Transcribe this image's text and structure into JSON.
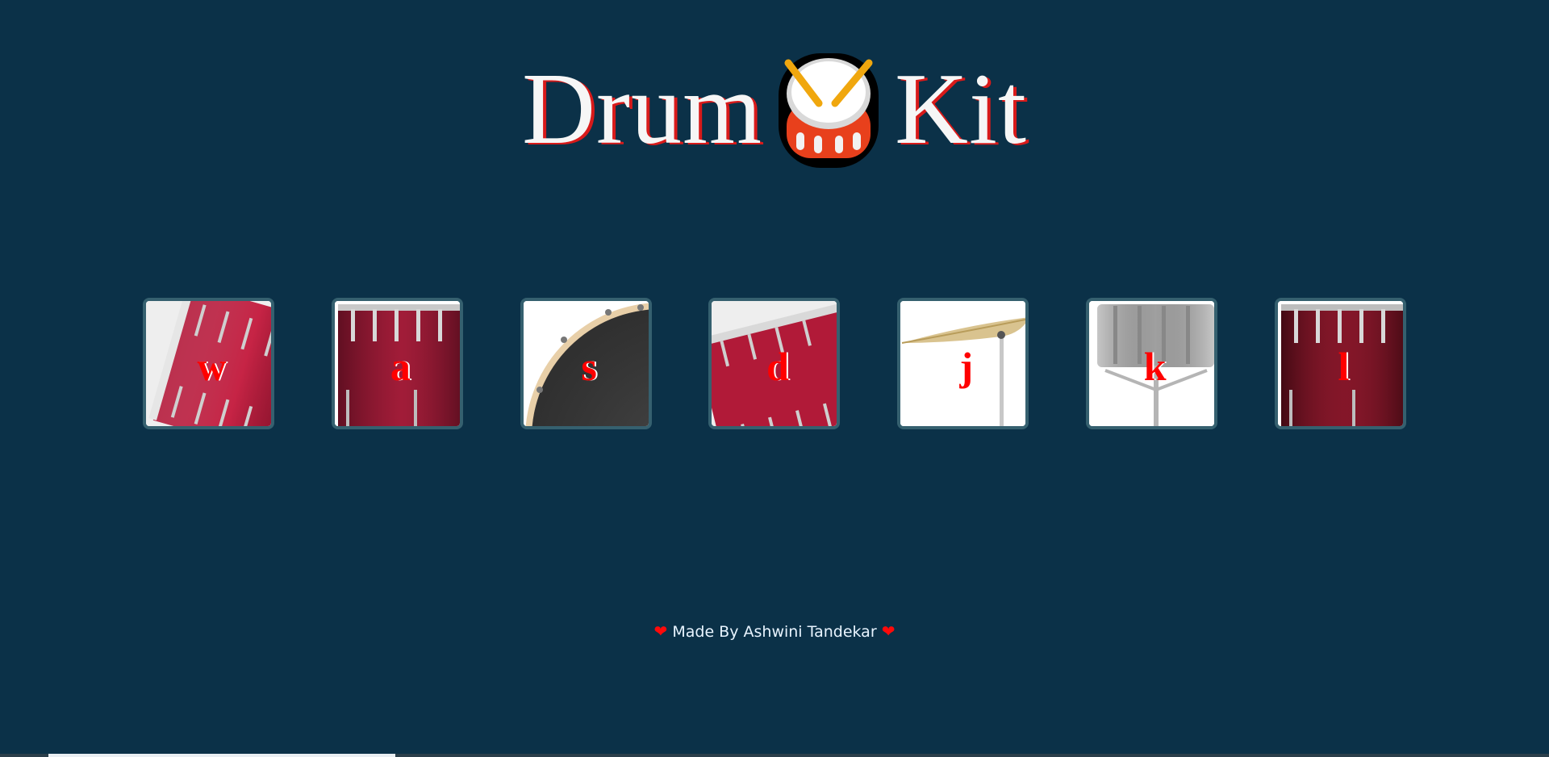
{
  "colors": {
    "background": "#0b3148",
    "title_text": "#f6f6f6",
    "title_shadow": "#d81a1a",
    "key_text": "#ff0000",
    "button_border": "#35606f",
    "footer_text": "#e8f4ff",
    "heart": "#ff0a0a"
  },
  "title": {
    "word1": "Drum",
    "icon": "drum-icon",
    "word2": "Kit"
  },
  "drums": [
    {
      "key": "w",
      "art": "crash-tom-tilted"
    },
    {
      "key": "a",
      "art": "kick-drum"
    },
    {
      "key": "s",
      "art": "snare-head"
    },
    {
      "key": "d",
      "art": "tom-tilted"
    },
    {
      "key": "j",
      "art": "cymbal"
    },
    {
      "key": "k",
      "art": "silver-snare"
    },
    {
      "key": "l",
      "art": "floor-tom"
    }
  ],
  "footer": {
    "heart_left": "❤",
    "text": "Made By Ashwini Tandekar",
    "heart_right": "❤"
  }
}
